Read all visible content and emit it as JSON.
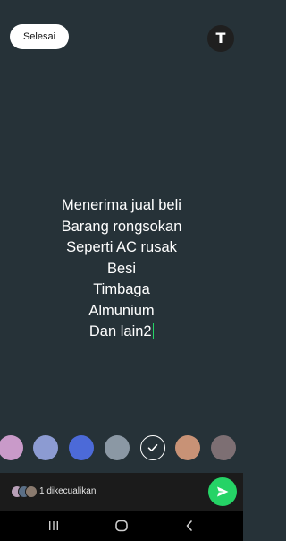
{
  "header": {
    "done_label": "Selesai",
    "text_tool_label": "T",
    "text_tool_icon": "text-tool-icon"
  },
  "message": {
    "lines": [
      "Menerima jual beli",
      "Barang rongsokan",
      "Seperti AC rusak",
      "Besi",
      "Timbaga",
      "Almunium",
      "Dan lain2"
    ],
    "text_color": "#ffffff",
    "cursor_color": "#25d366"
  },
  "colors": {
    "background": "#263238",
    "swatches": [
      "#c99ac9",
      "#8c9bd2",
      "#4c6ad8",
      "#8b98a4",
      "selected",
      "#c89276",
      "#7d6f73"
    ]
  },
  "footer": {
    "excluded_label": "1 dikecualikan",
    "send_icon": "send-icon",
    "accent": "#25d366"
  },
  "nav": {
    "recents_icon": "recents-icon",
    "home_icon": "home-icon",
    "back_icon": "back-icon"
  }
}
